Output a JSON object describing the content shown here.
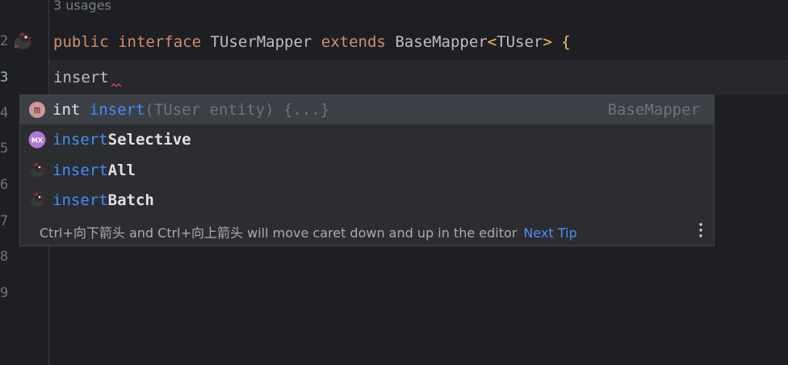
{
  "editor": {
    "usages": "3 usages",
    "line_numbers": [
      "2",
      "3",
      "4",
      "5",
      "6",
      "7",
      "8",
      "9"
    ],
    "line2": {
      "kw1": "public",
      "kw2": "interface",
      "name": "TUserMapper",
      "kw3": "extends",
      "base": "BaseMapper",
      "lt": "<",
      "generic": "TUser",
      "gt": ">",
      "brace": "{"
    },
    "line3": "insert"
  },
  "completion": {
    "items": [
      {
        "prefix": "int ",
        "match": "insert",
        "rest": "",
        "sig": "(TUser entity) {...}",
        "type": "BaseMapper",
        "icon": "method-icon"
      },
      {
        "prefix": "",
        "match": "insert",
        "rest": "Selective",
        "sig": "",
        "type": "",
        "icon": "mybatisx-icon"
      },
      {
        "prefix": "",
        "match": "insert",
        "rest": "All",
        "sig": "",
        "type": "",
        "icon": "mybatis-bird-icon"
      },
      {
        "prefix": "",
        "match": "insert",
        "rest": "Batch",
        "sig": "",
        "type": "",
        "icon": "mybatis-bird-icon"
      }
    ],
    "tip": "Ctrl+向下箭头 and Ctrl+向上箭头 will move caret down and up in the editor",
    "tip_link": "Next Tip"
  },
  "colors": {
    "background": "#1e1f22",
    "keyword": "#cf8e6d",
    "match": "#3f8ff7",
    "link": "#548af7"
  }
}
